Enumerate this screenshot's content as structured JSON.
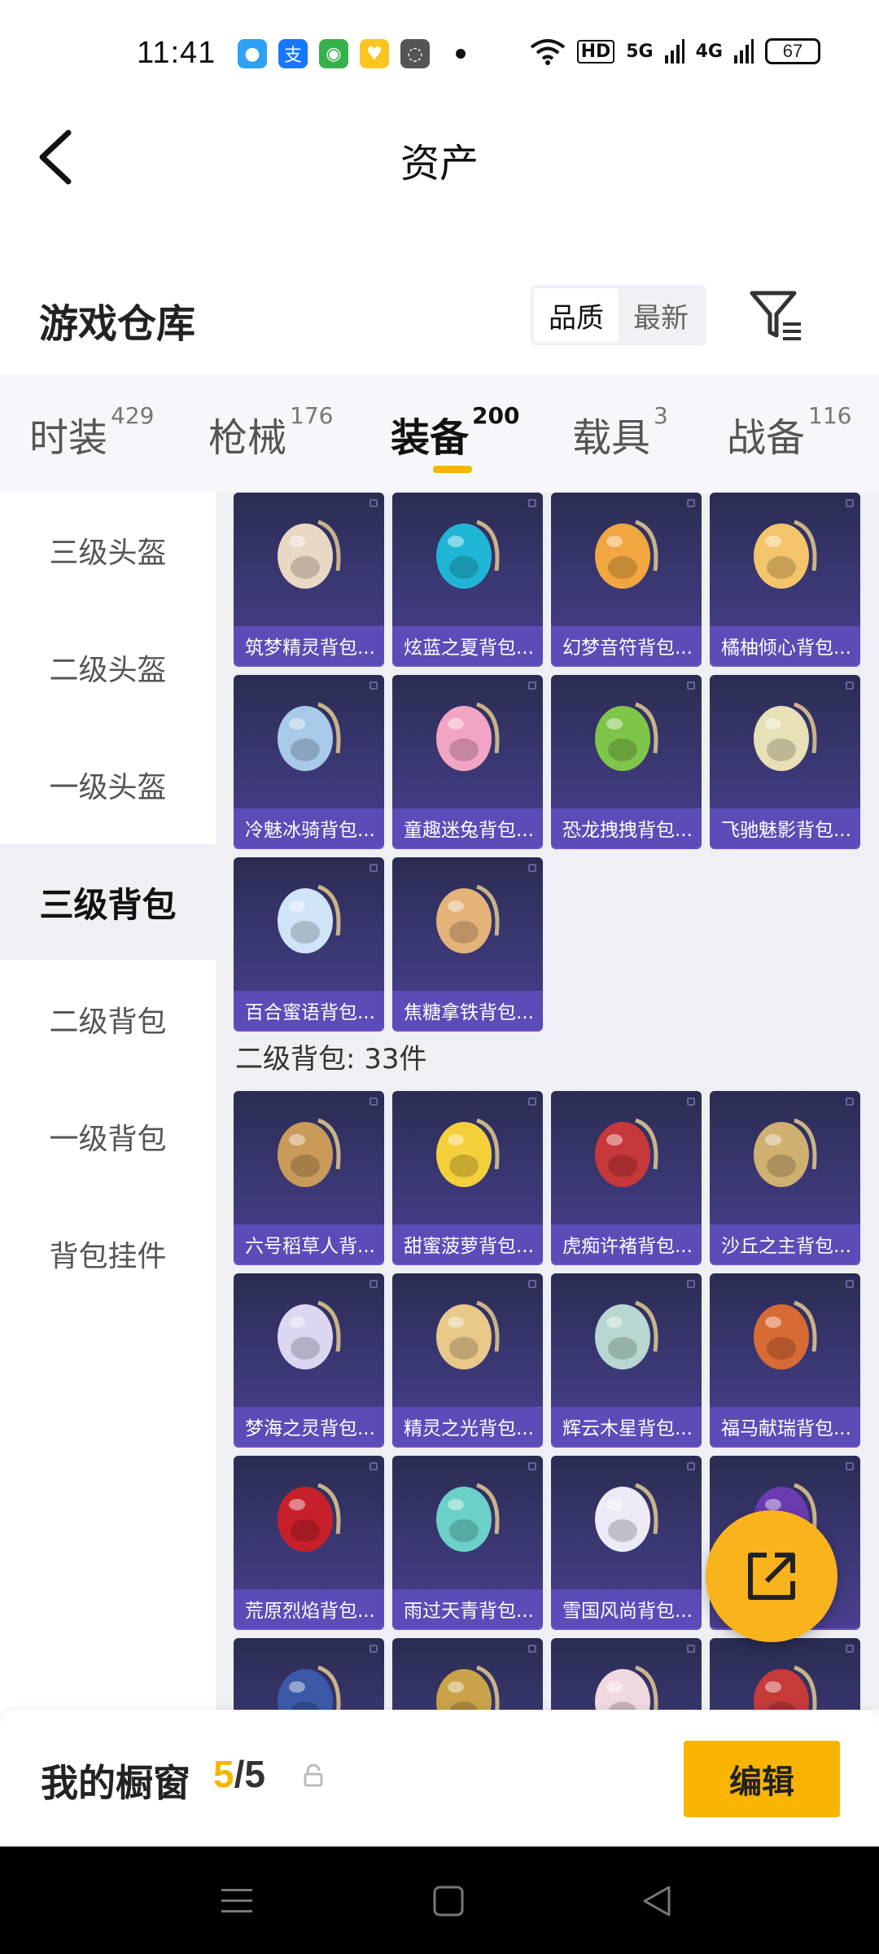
{
  "status_bar": {
    "time": "11:41",
    "apps": [
      {
        "icon": "penguin-icon",
        "color": "#2ea1f5",
        "glyph": "●"
      },
      {
        "icon": "alipay-icon",
        "color": "#1677ff",
        "glyph": "支"
      },
      {
        "icon": "panda-app-icon",
        "color": "#35b24b",
        "glyph": "◉"
      },
      {
        "icon": "heart-app-icon",
        "color": "#f9c522",
        "glyph": "♥"
      },
      {
        "icon": "chat-bubble-icon",
        "color": "#555555",
        "glyph": "◌"
      }
    ],
    "signal_1": "HD",
    "signal_2": "5G",
    "signal_3": "4G",
    "battery": "67"
  },
  "header": {
    "title": "资产"
  },
  "warehouse": {
    "title": "游戏仓库",
    "sort_options": [
      "品质",
      "最新"
    ],
    "sort_selected": "品质"
  },
  "tabs": [
    {
      "label": "时装",
      "count": "429"
    },
    {
      "label": "枪械",
      "count": "176"
    },
    {
      "label": "装备",
      "count": "200"
    },
    {
      "label": "载具",
      "count": "3"
    },
    {
      "label": "战备",
      "count": "116"
    }
  ],
  "active_tab": "装备",
  "sidebar": {
    "items": [
      "三级头盔",
      "二级头盔",
      "一级头盔",
      "三级背包",
      "二级背包",
      "一级背包",
      "背包挂件"
    ],
    "active": "三级背包"
  },
  "level3_backpacks": [
    {
      "name": "筑梦精灵背包...",
      "icon": "fairy-backpack-icon",
      "accent": "#e9d9c4"
    },
    {
      "name": "炫蓝之夏背包...",
      "icon": "blue-backpack-icon",
      "accent": "#1fb6d6"
    },
    {
      "name": "幻梦音符背包...",
      "icon": "rocket-backpack-icon",
      "accent": "#f1a640"
    },
    {
      "name": "橘柚倾心背包...",
      "icon": "orange-backpack-icon",
      "accent": "#f4c46a"
    },
    {
      "name": "冷魅冰骑背包...",
      "icon": "ice-knight-backpack-icon",
      "accent": "#a9c9e8"
    },
    {
      "name": "童趣迷兔背包...",
      "icon": "bunny-backpack-icon",
      "accent": "#f2a4c4"
    },
    {
      "name": "恐龙拽拽背包...",
      "icon": "dinosaur-backpack-icon",
      "accent": "#7fc54a"
    },
    {
      "name": "飞驰魅影背包...",
      "icon": "racer-backpack-icon",
      "accent": "#e8e0b6"
    },
    {
      "name": "百合蜜语背包...",
      "icon": "lily-backpack-icon",
      "accent": "#cfe4f6"
    },
    {
      "name": "焦糖拿铁背包...",
      "icon": "latte-backpack-icon",
      "accent": "#e3b37a"
    }
  ],
  "level2_section": {
    "header": "二级背包: 33件"
  },
  "level2_backpacks": [
    {
      "name": "六号稻草人背...",
      "icon": "scarecrow-backpack-icon",
      "accent": "#c99a5a"
    },
    {
      "name": "甜蜜菠萝背包...",
      "icon": "pineapple-backpack-icon",
      "accent": "#f3cf3a"
    },
    {
      "name": "虎痴许褚背包...",
      "icon": "tiger-backpack-icon",
      "accent": "#c7383a"
    },
    {
      "name": "沙丘之主背包...",
      "icon": "dune-backpack-icon",
      "accent": "#d0b070"
    },
    {
      "name": "梦海之灵背包...",
      "icon": "shell-backpack-icon",
      "accent": "#dcd6f0"
    },
    {
      "name": "精灵之光背包...",
      "icon": "sprite-backpack-icon",
      "accent": "#e8c98a"
    },
    {
      "name": "辉云木星背包...",
      "icon": "jupiter-backpack-icon",
      "accent": "#b7d7d0"
    },
    {
      "name": "福马献瑞背包...",
      "icon": "horse-backpack-icon",
      "accent": "#d86a35"
    },
    {
      "name": "荒原烈焰背包...",
      "icon": "flame-backpack-icon",
      "accent": "#c8202a"
    },
    {
      "name": "雨过天青背包...",
      "icon": "sky-backpack-icon",
      "accent": "#6ad0c8"
    },
    {
      "name": "雪国风尚背包...",
      "icon": "snowman-backpack-icon",
      "accent": "#ecebf5"
    },
    {
      "name": "",
      "icon": "purple-backpack-icon",
      "accent": "#6b3bb0"
    },
    {
      "name": "",
      "icon": "card-backpack-icon",
      "accent": "#3a5aa8"
    },
    {
      "name": "",
      "icon": "black-gold-backpack-icon",
      "accent": "#c9a24a"
    },
    {
      "name": "",
      "icon": "cat-backpack-icon",
      "accent": "#f0d8e0"
    },
    {
      "name": "",
      "icon": "red-school-backpack-icon",
      "accent": "#c63a3a"
    }
  ],
  "showcase": {
    "title": "我的橱窗",
    "count_used": "5",
    "count_total": "/5",
    "edit_label": "编辑"
  }
}
